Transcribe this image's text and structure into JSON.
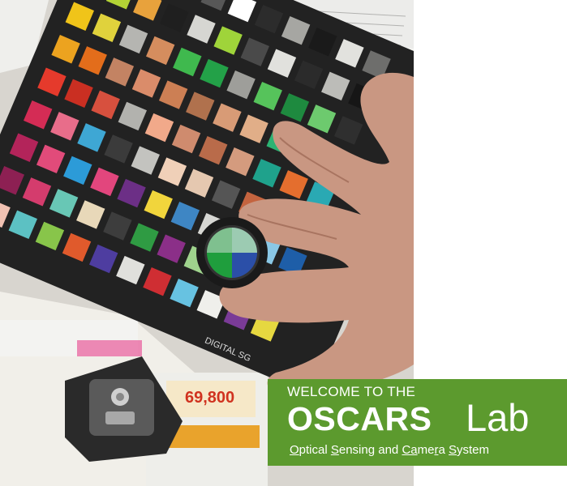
{
  "banner": {
    "welcome": "WELCOME TO THE",
    "name": "OSCARS",
    "lab": "Lab",
    "subtitle_parts": [
      {
        "text": "O",
        "underline": true
      },
      {
        "text": "ptical ",
        "underline": false
      },
      {
        "text": "S",
        "underline": true
      },
      {
        "text": "ensing and ",
        "underline": false
      },
      {
        "text": "Ca",
        "underline": true
      },
      {
        "text": "me",
        "underline": false
      },
      {
        "text": "r",
        "underline": true
      },
      {
        "text": "a ",
        "underline": false
      },
      {
        "text": "S",
        "underline": true
      },
      {
        "text": "ystem",
        "underline": false
      }
    ],
    "background_color": "#5c9a2e",
    "text_color": "#ffffff"
  },
  "photo": {
    "card_label": "DIGITAL SG",
    "visible_prices": [
      "69,800"
    ],
    "chart_colors": [
      [
        "#f2f2ee",
        "#8a8a88",
        "#3a3a3a",
        "#c9c9c5",
        "#575757",
        "#ffffff",
        "#2c2c2c",
        "#a6a6a2",
        "#1a1a1a",
        "#e2e2de",
        "#6e6e6c"
      ],
      [
        "#7a3b2a",
        "#b3d335",
        "#e8a23c",
        "#1f1f1f",
        "#d6d6d2",
        "#9fd43a",
        "#4a4a4a",
        "#e1e1dd",
        "#2b2b2b",
        "#bcbcb8",
        "#161616"
      ],
      [
        "#f0c419",
        "#e0d23c",
        "#b5b5b1",
        "#d58d5e",
        "#3fb94e",
        "#23a148",
        "#9e9e9a",
        "#56c35b",
        "#1e8a3f",
        "#6dca6e",
        "#2f2f2f"
      ],
      [
        "#eca31f",
        "#e36d1b",
        "#c38363",
        "#da8c6a",
        "#cc7f54",
        "#b0714d",
        "#d89b76",
        "#e1ae88",
        "#2bb373",
        "#149b63",
        "#33a8a0"
      ],
      [
        "#e53a2c",
        "#ca2f22",
        "#d7503e",
        "#b2b2ae",
        "#f1a98a",
        "#cf8b6e",
        "#b96b4a",
        "#d49b7e",
        "#1fa28c",
        "#e46e2e",
        "#2aa9b3"
      ],
      [
        "#d42c55",
        "#e86d8a",
        "#3ea7d4",
        "#3b3b3b",
        "#c3c3bf",
        "#f0d0b8",
        "#e5c8b0",
        "#555555",
        "#c4643f",
        "#3a98c8",
        "#2e7bbf"
      ],
      [
        "#b3245a",
        "#e14b7a",
        "#2c9bd8",
        "#e2467d",
        "#6c2f86",
        "#f1d53c",
        "#3e86c4",
        "#d7d7d3",
        "#2f2f2f",
        "#8ac8e6",
        "#1e5ea8"
      ],
      [
        "#8d2053",
        "#d43c6d",
        "#68c7b5",
        "#e8d8b9",
        "#3d3d3d",
        "#2f9b43",
        "#8b2f88",
        "#9fd38d",
        "#b3b3af",
        "#2fa3d8",
        "#24396b"
      ],
      [
        "#f0c1b2",
        "#5cc1c3",
        "#88c54a",
        "#e05a2c",
        "#4e3da0",
        "#e0e0dc",
        "#cf2e33",
        "#67c2e1",
        "#efefeb",
        "#7a3b97",
        "#e6d840"
      ]
    ]
  }
}
